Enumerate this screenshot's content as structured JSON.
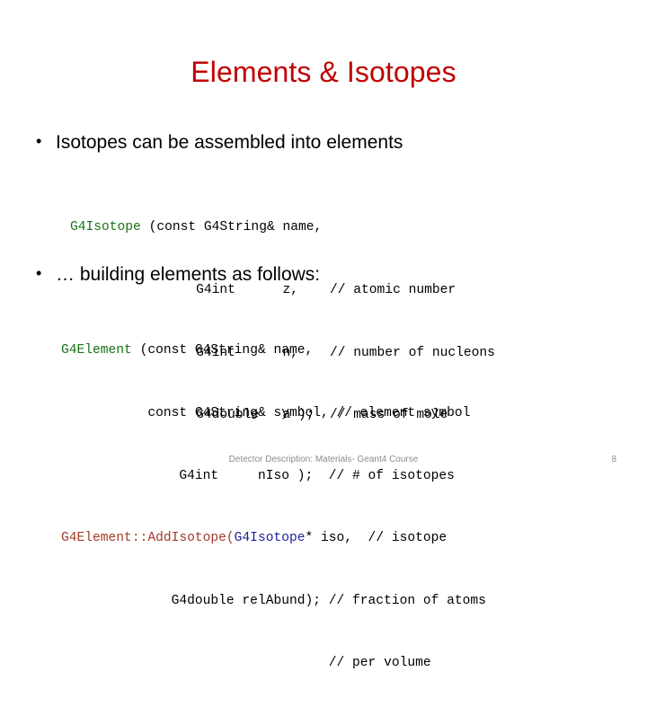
{
  "slide": {
    "title": "Elements & Isotopes",
    "title_color": "#c00000",
    "background": "#ffffff"
  },
  "bullets": [
    {
      "marker": "•",
      "text": "Isotopes can be assembled into elements"
    },
    {
      "marker": "•",
      "text": "… building elements as follows:"
    }
  ],
  "code_blocks": [
    {
      "name": "g4isotope-constructor",
      "lines": [
        {
          "green": "G4Isotope",
          "rest": " (const G4String& name,"
        },
        {
          "green": "",
          "rest": "                G4int      z,    // atomic number"
        },
        {
          "green": "",
          "rest": "                G4int      n,    // number of nucleons"
        },
        {
          "green": "",
          "rest": "                G4double   a );  // mass of mole"
        }
      ]
    },
    {
      "name": "g4element-constructor",
      "lines": [
        {
          "green": "G4Element",
          "rest": " (const G4String& name,"
        },
        {
          "green": "",
          "rest": "           const G4String& symbol, // element symbol"
        },
        {
          "green": "",
          "rest": "               G4int     nIso );  // # of isotopes"
        }
      ]
    }
  ],
  "code_addisotope": {
    "name": "g4element-addisotope",
    "line1_maroon": "G4Element::AddIsotope(",
    "line1_blue": "G4Isotope",
    "line1_plain": "* iso,  // isotope",
    "line2": "              G4double relAbund); // fraction of atoms",
    "line3": "                                  // per volume"
  },
  "colors": {
    "keyword_green": "#147314",
    "method_maroon": "#a33a28",
    "type_blue": "#21219c",
    "title_red": "#c00000",
    "footer_gray": "#8c8c8c"
  },
  "footer": {
    "text": "Detector Description: Materials- Geant4 Course",
    "page_number": "8"
  }
}
